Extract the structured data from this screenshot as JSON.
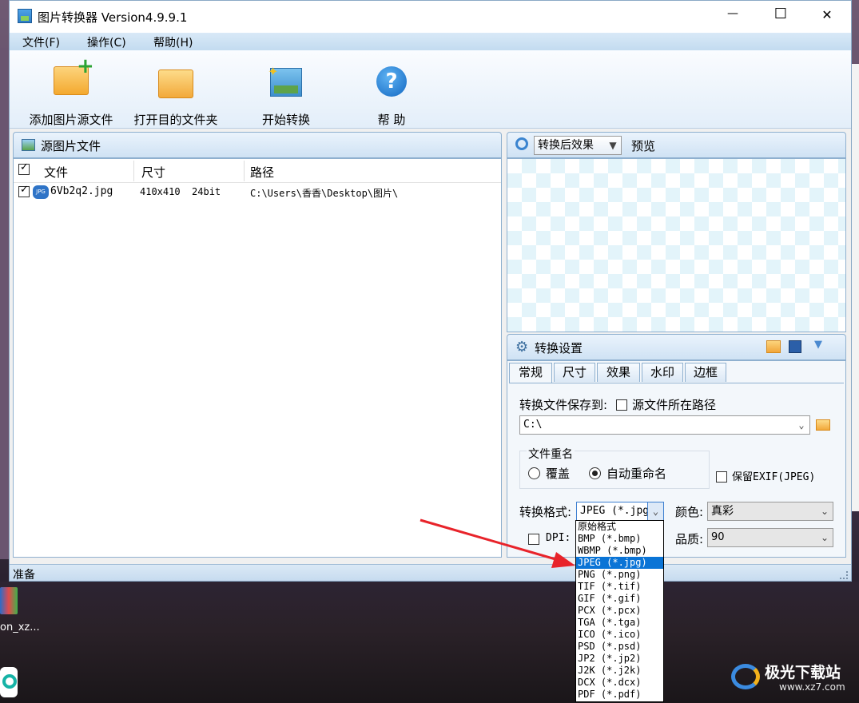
{
  "window": {
    "title": "图片转换器 Version4.9.9.1",
    "minimize": "—",
    "maximize": "☐",
    "close": "✕"
  },
  "menu": [
    "文件(F)",
    "操作(C)",
    "帮助(H)"
  ],
  "toolbar": {
    "add": "添加图片源文件",
    "open": "打开目的文件夹",
    "start": "开始转换",
    "help": "帮 助"
  },
  "source_panel": {
    "title": "源图片文件",
    "columns": [
      "文件",
      "尺寸",
      "路径"
    ],
    "rows": [
      {
        "file": "6Vb2q2.jpg",
        "size": "410x410  24bit",
        "path": "C:\\Users\\香香\\Desktop\\图片\\"
      }
    ]
  },
  "preview_panel": {
    "mode": "转换后效果",
    "label": "预览"
  },
  "settings": {
    "title": "转换设置",
    "tabs": [
      "常规",
      "尺寸",
      "效果",
      "水印",
      "边框"
    ],
    "save_to_label": "转换文件保存到:",
    "source_path_label": "源文件所在路径",
    "path_value": "C:\\",
    "rename_group": "文件重名",
    "overwrite": "覆盖",
    "auto_rename": "自动重命名",
    "keep_exif": "保留EXIF(JPEG)",
    "format_label": "转换格式:",
    "format_value": "JPEG (*.jpg)",
    "color_label": "颜色:",
    "color_value": "真彩",
    "dpi_label": "DPI:",
    "quality_label": "品质:",
    "quality_value": "90"
  },
  "format_options": [
    "原始格式",
    "BMP (*.bmp)",
    "WBMP (*.bmp)",
    "JPEG (*.jpg)",
    "PNG (*.png)",
    "TIF (*.tif)",
    "GIF (*.gif)",
    "PCX (*.pcx)",
    "TGA (*.tga)",
    "ICO (*.ico)",
    "PSD (*.psd)",
    "JP2 (*.jp2)",
    "J2K (*.j2k)",
    "DCX (*.dcx)",
    "PDF (*.pdf)"
  ],
  "status": "准备",
  "desktop": {
    "icon_label": "on_xz...",
    "watermark_name": "极光下载站",
    "watermark_url": "www.xz7.com"
  },
  "accent": "#0a74d6"
}
